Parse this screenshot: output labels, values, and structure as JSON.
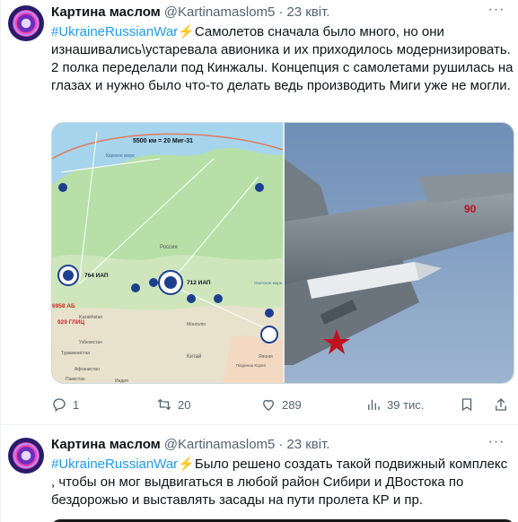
{
  "tweets": [
    {
      "author": {
        "name": "Картина маслом",
        "handle": "@Kartinamaslom5",
        "date": "23 квіт."
      },
      "hashtag": "#UkraineRussianWar",
      "emoji": "⚡",
      "text": "Самолетов сначала было много, но они изнашивались\\устаревала авионика и их приходилось модернизировать. 2 полка переделали под Кинжалы. Концепция с самолетами рушилась на глазах и нужно было что-то делать ведь производить Миги уже не могли.",
      "map": {
        "headline": "5500 км = 20 Миг-31",
        "country": "Россия",
        "regiment_764": "764 ИАП",
        "regiment_712": "712 ИАП",
        "unit_6958": "6958 АБ",
        "unit_929": "929 ГЛИЦ",
        "labels": [
          "Карское море",
          "Kazakhstan",
          "Монголія",
          "Узбекистан",
          "Туркменистан",
          "Китай",
          "Афганистан",
          "Пакистан",
          "Японія",
          "Південна Корея",
          "Охотское море",
          "Индия"
        ]
      },
      "photo": {
        "tail_number": "90"
      },
      "stats": {
        "replies": "1",
        "retweets": "20",
        "likes": "289",
        "views": "39 тис."
      },
      "icons": {
        "more": "more-icon",
        "reply": "reply-icon",
        "retweet": "retweet-icon",
        "like": "heart-icon",
        "views": "views-icon",
        "bookmark": "bookmark-icon",
        "share": "share-icon"
      }
    },
    {
      "author": {
        "name": "Картина маслом",
        "handle": "@Kartinamaslom5",
        "date": "23 квіт."
      },
      "hashtag": "#UkraineRussianWar",
      "emoji": "⚡",
      "text": "Было решено создать такой подвижный комплекс , чтобы он мог выдвигаться в любой район Сибири и ДВостока по бездорожью и выставлять засады на пути пролета КР и пр."
    }
  ],
  "colors": {
    "link": "#1d9bf0",
    "secondary_text": "#536471",
    "primary_text": "#0f1419",
    "border": "#eff3f4"
  }
}
